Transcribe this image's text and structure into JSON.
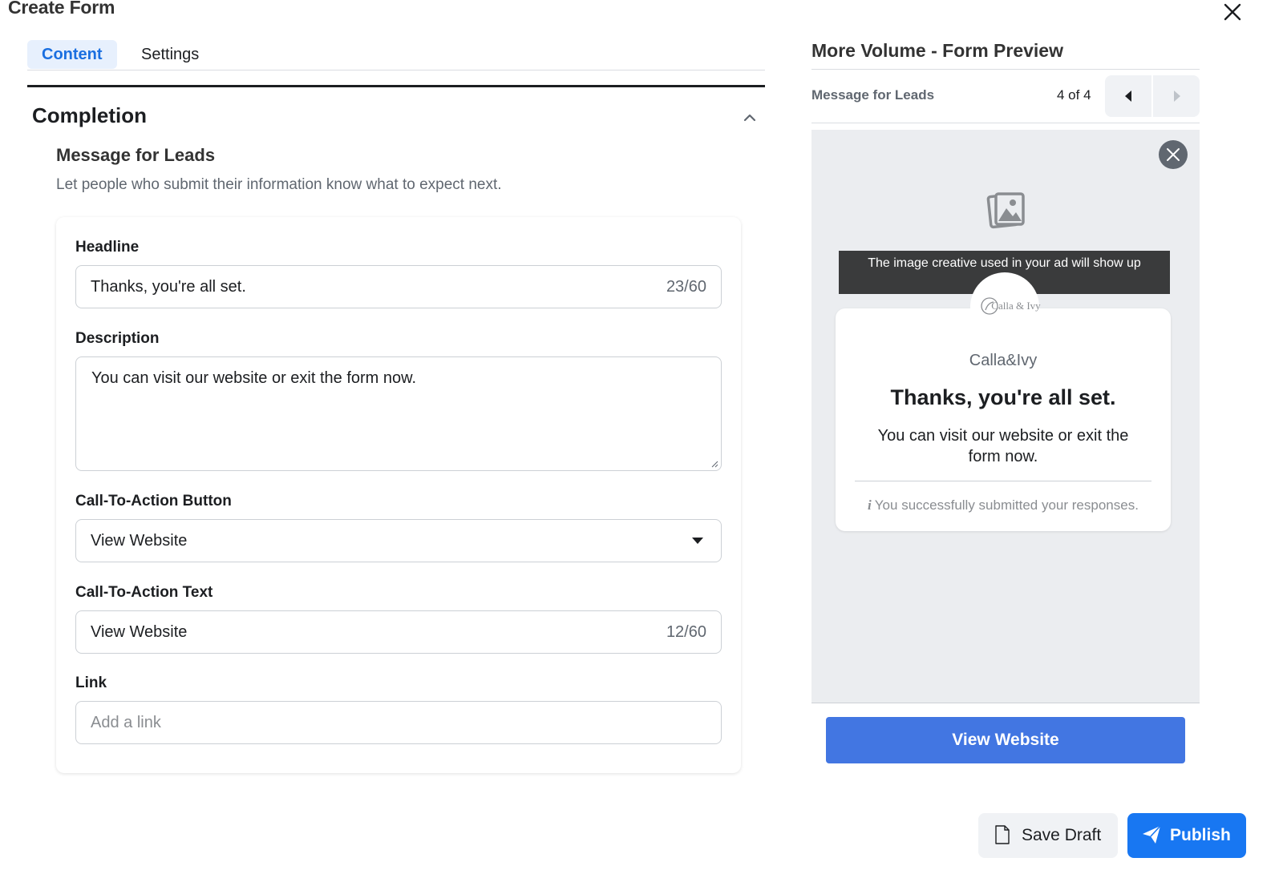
{
  "window": {
    "title": "Create Form",
    "close_icon": "close-x-icon"
  },
  "tabs": [
    {
      "label": "Content",
      "active": true
    },
    {
      "label": "Settings",
      "active": false
    }
  ],
  "section": {
    "title": "Completion",
    "collapse_icon": "chevron-up-icon",
    "subtitle": "Message for Leads",
    "description": "Let people who submit their information know what to expect next."
  },
  "form": {
    "headline": {
      "label": "Headline",
      "value": "Thanks, you're all set.",
      "count": "23/60"
    },
    "description": {
      "label": "Description",
      "value": "You can visit our website or exit the form now."
    },
    "cta_button": {
      "label": "Call-To-Action Button",
      "value": "View Website"
    },
    "cta_text": {
      "label": "Call-To-Action Text",
      "value": "View Website",
      "count": "12/60"
    },
    "link": {
      "label": "Link",
      "value": "",
      "placeholder": "Add a link"
    }
  },
  "preview": {
    "title": "More Volume - Form Preview",
    "step_label": "Message for Leads",
    "step_count": "4 of 4",
    "banner": "The image creative used in your ad will show up",
    "logo_text": "Calla & Ivy",
    "brand": "Calla&Ivy",
    "headline": "Thanks, you're all set.",
    "description": "You can visit our website or exit the form now.",
    "note_icon": "info-icon",
    "note": "You successfully submitted your responses.",
    "cta": "View Website"
  },
  "footer": {
    "save_label": "Save Draft",
    "publish_label": "Publish"
  },
  "colors": {
    "accent": "#1877f2",
    "preview_cta": "#4276e2",
    "tab_active_bg": "#e7f0fd"
  }
}
